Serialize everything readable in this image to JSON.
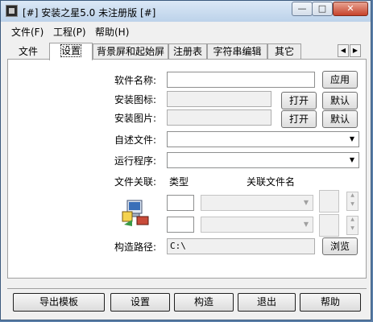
{
  "window": {
    "title": "[#] 安装之星5.0 未注册版 [#]"
  },
  "window_controls": {
    "minimize": "—",
    "maximize": "□",
    "close": "✕"
  },
  "menu": [
    {
      "label": "文件(F)"
    },
    {
      "label": "工程(P)"
    },
    {
      "label": "帮助(H)"
    }
  ],
  "tabs": [
    {
      "label": "文件"
    },
    {
      "label": "设置"
    },
    {
      "label": "背景屏和起始屏"
    },
    {
      "label": "注册表"
    },
    {
      "label": "字符串编辑"
    },
    {
      "label": "其它"
    }
  ],
  "tab_scroll": {
    "left": "◀",
    "right": "▶"
  },
  "form": {
    "software_name_label": "软件名称:",
    "software_name_value": "",
    "apply_button": "应用",
    "install_icon_label": "安装图标:",
    "install_image_label": "安装图片:",
    "open_button": "打开",
    "default_button": "默认",
    "readme_label": "自述文件:",
    "run_program_label": "运行程序:",
    "file_assoc_label": "文件关联:",
    "type_label": "类型",
    "assoc_filename_label": "关联文件名",
    "build_path_label": "构造路径:",
    "build_path_value": "C:\\",
    "browse_button": "浏览"
  },
  "combo_arrow": "▼",
  "spin_arrows": {
    "up": "▲",
    "down": "▼"
  },
  "bottom_buttons": [
    "导出模板",
    "设置",
    "构造",
    "退出",
    "帮助"
  ]
}
